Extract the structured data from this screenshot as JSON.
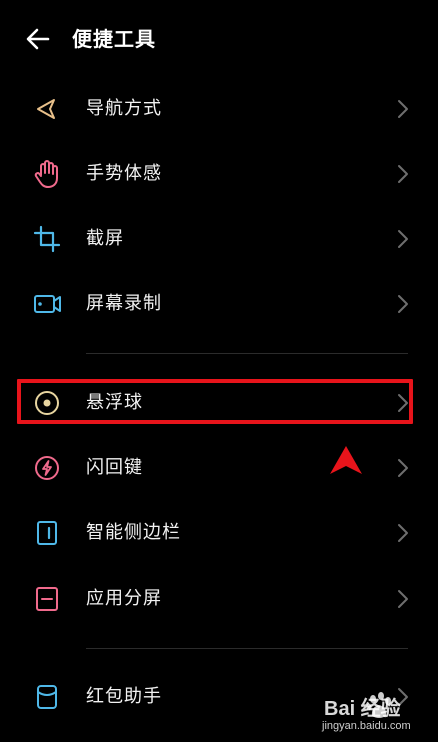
{
  "header": {
    "title": "便捷工具"
  },
  "items": [
    {
      "label": "导航方式",
      "icon": "navigation-icon",
      "color": "#e8c08a"
    },
    {
      "label": "手势体感",
      "icon": "hand-gesture-icon",
      "color": "#f06a8c"
    },
    {
      "label": "截屏",
      "icon": "crop-screenshot-icon",
      "color": "#4fb8e8"
    },
    {
      "label": "屏幕录制",
      "icon": "screen-record-icon",
      "color": "#4fb8e8"
    },
    {
      "label": "悬浮球",
      "icon": "floating-ball-icon",
      "color": "#e8d5a0"
    },
    {
      "label": "闪回键",
      "icon": "flashback-key-icon",
      "color": "#f06a8c"
    },
    {
      "label": "智能侧边栏",
      "icon": "smart-sidebar-icon",
      "color": "#4fb8e8"
    },
    {
      "label": "应用分屏",
      "icon": "split-screen-icon",
      "color": "#f06a8c"
    },
    {
      "label": "红包助手",
      "icon": "red-packet-assistant-icon",
      "color": "#4fb8e8"
    }
  ],
  "watermark": {
    "brand": "Bai 经验",
    "url": "jingyan.baidu.com"
  },
  "colors": {
    "background": "#000000",
    "highlight_border": "#e8141b",
    "chevron": "#6e6e6e",
    "divider": "#2b2b2b"
  }
}
